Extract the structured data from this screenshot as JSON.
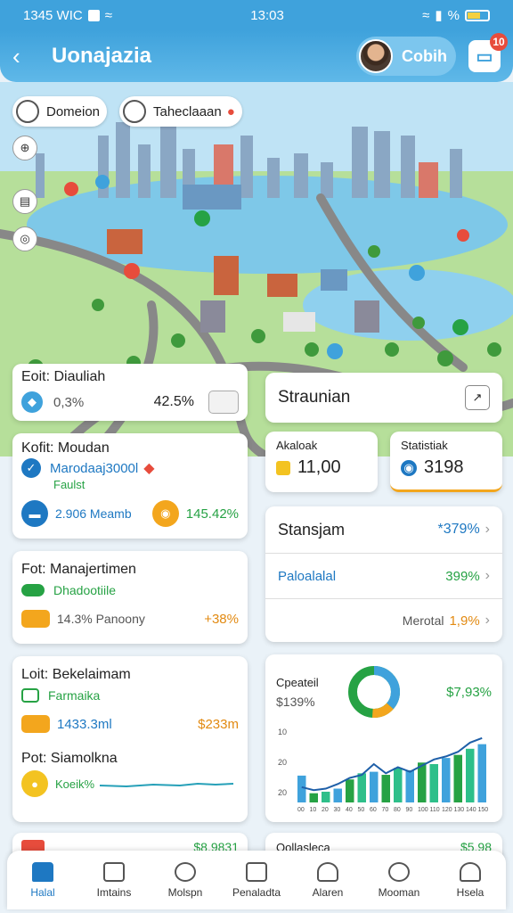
{
  "status": {
    "left": "1345 WIC",
    "time": "13:03",
    "right": "%"
  },
  "appbar": {
    "title": "Uonajazia",
    "profile_name": "Cobih",
    "notif_count": "10"
  },
  "map": {
    "chip1": "Domeion",
    "chip2": "Taheclaaan"
  },
  "left_cards": {
    "c1": {
      "label": "Eoit: Diauliah",
      "value1": "0,3%",
      "value2": "42.5%"
    },
    "c2": {
      "label": "Kofit: Moudan",
      "subtitle": "Marodaaj3000l",
      "sub2": "Faulst",
      "stat1": "2.906 Meamb",
      "stat2": "145.42%"
    },
    "c3": {
      "label": "Fot: Manajertimen",
      "tag": "Dhadootiile",
      "stat1": "14.3% Panoony",
      "stat2": "+38%"
    },
    "c4": {
      "label": "Loit: Bekelaimam",
      "tag": "Farmaika",
      "stat1": "1433.3ml",
      "stat2": "$233m",
      "label2": "Pot: Siamolkna",
      "tag2": "Koeik%"
    },
    "c5_partial": "$8,9831"
  },
  "right_cards": {
    "stat_header": "Straunian",
    "akaloak": {
      "label": "Akaloak",
      "value": "11,00"
    },
    "statistik": {
      "label": "Statistiak",
      "value": "3198"
    },
    "list": {
      "title": "Stansjam",
      "title_value": "*379%",
      "row2": "Paloalalal",
      "row2_value": "399%",
      "row3": "Merotal",
      "row3_value": "1,9%"
    },
    "chart_card": {
      "label": "Cpeateil",
      "value": "$139%",
      "green_value": "$7,93%",
      "partial": "Oollasleca",
      "partial_value": "$5,98"
    }
  },
  "colors": {
    "accent": "#3fa2dc",
    "green": "#26a244",
    "orange": "#e28a12",
    "blue": "#1e78c2"
  },
  "nav": [
    {
      "label": "Halal"
    },
    {
      "label": "Imtains"
    },
    {
      "label": "Molspn"
    },
    {
      "label": "Penaladta"
    },
    {
      "label": "Alaren"
    },
    {
      "label": "Mooman"
    },
    {
      "label": "Hsela"
    }
  ],
  "chart_data": {
    "type": "bar",
    "categories": [
      "00",
      "10",
      "20",
      "30",
      "40",
      "50",
      "60",
      "70",
      "80",
      "90",
      "100",
      "110",
      "120",
      "130",
      "140",
      "150"
    ],
    "values": [
      35,
      12,
      14,
      18,
      30,
      38,
      40,
      36,
      45,
      42,
      52,
      50,
      58,
      62,
      70,
      76
    ],
    "line": [
      20,
      16,
      18,
      24,
      32,
      36,
      50,
      38,
      46,
      40,
      48,
      56,
      60,
      66,
      78,
      84
    ],
    "yticks": [
      "10",
      "20",
      "20"
    ],
    "ylim": [
      0,
      100
    ]
  }
}
